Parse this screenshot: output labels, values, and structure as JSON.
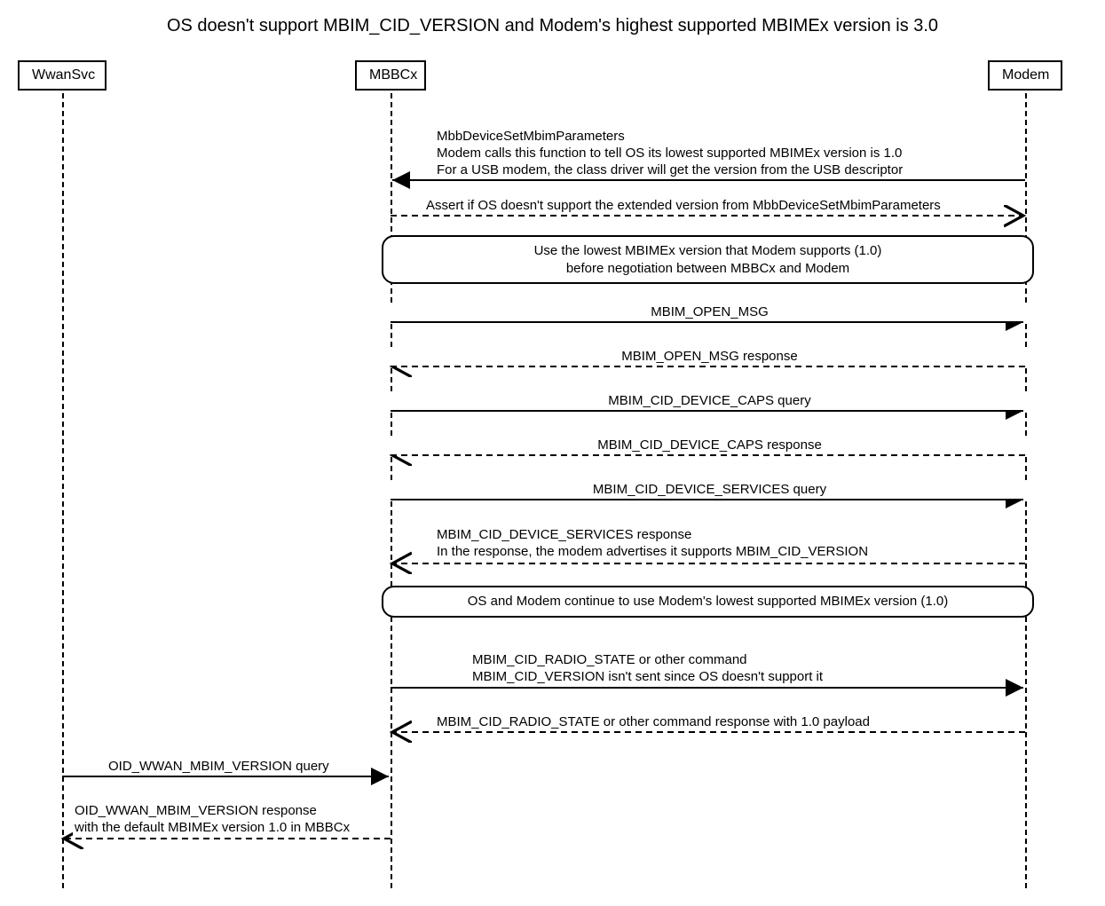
{
  "title": "OS doesn't support MBIM_CID_VERSION and Modem's highest supported MBIMEx version is 3.0",
  "participants": {
    "wwansvc": "WwanSvc",
    "mbbcx": "MBBCx",
    "modem": "Modem"
  },
  "messages": {
    "m1_l1": "MbbDeviceSetMbimParameters",
    "m1_l2": "Modem calls this function to tell OS its lowest supported MBIMEx version is 1.0",
    "m1_l3": "For a USB modem, the class driver will get the version from the USB descriptor",
    "m2": "Assert if OS doesn't support the extended version from MbbDeviceSetMbimParameters",
    "note1_l1": "Use the lowest MBIMEx version that Modem supports (1.0)",
    "note1_l2": "before negotiation between MBBCx and Modem",
    "m3": "MBIM_OPEN_MSG",
    "m4": "MBIM_OPEN_MSG response",
    "m5": "MBIM_CID_DEVICE_CAPS query",
    "m6": "MBIM_CID_DEVICE_CAPS response",
    "m7": "MBIM_CID_DEVICE_SERVICES query",
    "m8_l1": "MBIM_CID_DEVICE_SERVICES response",
    "m8_l2": "In the response, the modem advertises it supports MBIM_CID_VERSION",
    "note2": "OS and Modem continue to use Modem's lowest supported MBIMEx version (1.0)",
    "m9_l1": "MBIM_CID_RADIO_STATE or other command",
    "m9_l2": "MBIM_CID_VERSION isn't sent since OS doesn't support it",
    "m10": "MBIM_CID_RADIO_STATE or other command response with 1.0 payload",
    "m11": "OID_WWAN_MBIM_VERSION query",
    "m12_l1": "OID_WWAN_MBIM_VERSION response",
    "m12_l2": "with the default MBIMEx version 1.0 in MBBCx"
  }
}
